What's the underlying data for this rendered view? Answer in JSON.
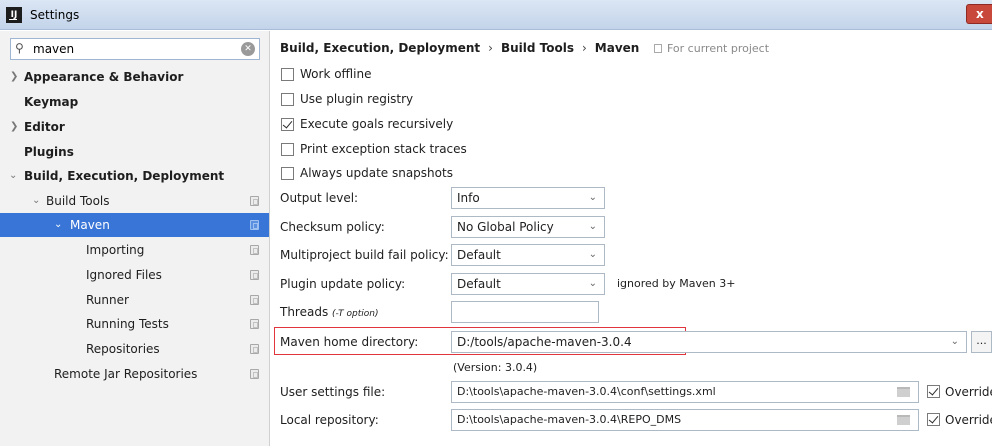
{
  "window": {
    "title": "Settings",
    "close_glyph": "x"
  },
  "search": {
    "value": "maven"
  },
  "sidebar": {
    "items": [
      {
        "label": "Appearance & Behavior"
      },
      {
        "label": "Keymap"
      },
      {
        "label": "Editor"
      },
      {
        "label": "Plugins"
      },
      {
        "label": "Build, Execution, Deployment"
      },
      {
        "label": "Build Tools"
      },
      {
        "label": "Maven"
      },
      {
        "label": "Importing"
      },
      {
        "label": "Ignored Files"
      },
      {
        "label": "Runner"
      },
      {
        "label": "Running Tests"
      },
      {
        "label": "Repositories"
      },
      {
        "label": "Remote Jar Repositories"
      }
    ]
  },
  "breadcrumb": {
    "level1": "Build, Execution, Deployment",
    "level2": "Build Tools",
    "level3": "Maven",
    "separator": "›"
  },
  "scope_note": "For current project",
  "options": {
    "work_offline": {
      "label": "Work offline",
      "checked": false
    },
    "use_plugin_registry": {
      "label": "Use plugin registry",
      "checked": false
    },
    "execute_goals_recursively": {
      "label": "Execute goals recursively",
      "checked": true
    },
    "print_exception_stack_traces": {
      "label": "Print exception stack traces",
      "checked": false
    },
    "always_update_snapshots": {
      "label": "Always update snapshots",
      "checked": false
    }
  },
  "fields": {
    "output_level": {
      "label": "Output level:",
      "value": "Info"
    },
    "checksum_policy": {
      "label": "Checksum policy:",
      "value": "No Global Policy"
    },
    "multiproject_fail_policy": {
      "label": "Multiproject build fail policy:",
      "value": "Default"
    },
    "plugin_update_policy": {
      "label": "Plugin update policy:",
      "value": "Default",
      "hint": "ignored by Maven 3+"
    },
    "threads": {
      "label": "Threads",
      "note": "(-T option)",
      "value": ""
    },
    "maven_home": {
      "label": "Maven home directory:",
      "value": "D:/tools/apache-maven-3.0.4",
      "version": "(Version: 3.0.4)",
      "browse_label": "..."
    },
    "user_settings": {
      "label": "User settings file:",
      "value": "D:\\tools\\apache-maven-3.0.4\\conf\\settings.xml",
      "override_label": "Override",
      "override_checked": true
    },
    "local_repository": {
      "label": "Local repository:",
      "value": "D:\\tools\\apache-maven-3.0.4\\REPO_DMS",
      "override_label": "Override",
      "override_checked": true
    }
  },
  "colors": {
    "selection": "#3875d7",
    "highlight_border": "#e0353d",
    "close_button": "#c9483c"
  }
}
